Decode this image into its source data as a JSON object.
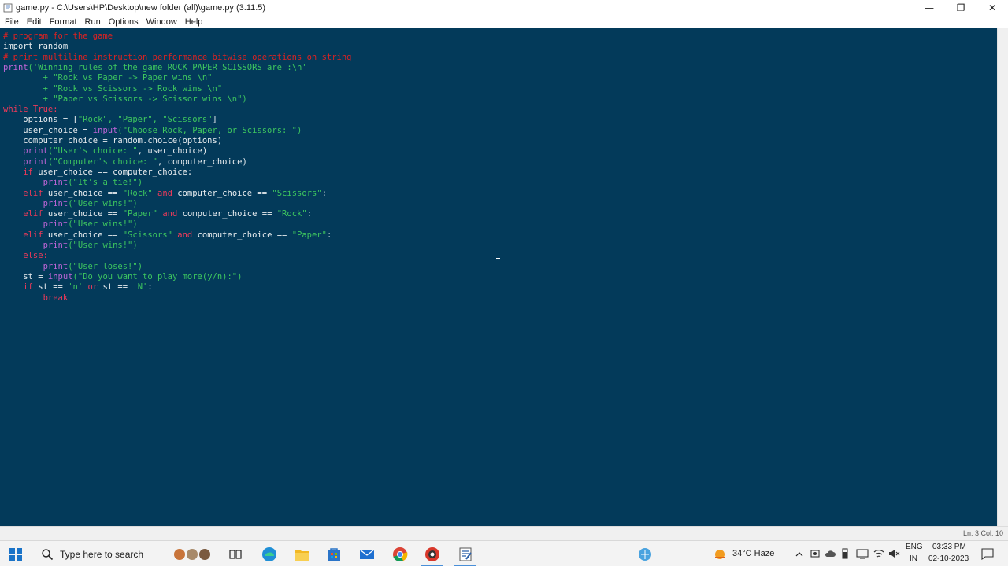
{
  "window": {
    "title": "game.py - C:\\Users\\HP\\Desktop\\new folder (all)\\game.py (3.11.5)",
    "controls": {
      "minimize": "—",
      "restore": "❐",
      "close": "✕"
    }
  },
  "menu": [
    "File",
    "Edit",
    "Format",
    "Run",
    "Options",
    "Window",
    "Help"
  ],
  "code_lines": [
    [
      {
        "t": "# program for the game",
        "c": "comment"
      }
    ],
    [
      {
        "t": "import random",
        "c": "plain"
      }
    ],
    [
      {
        "t": "# print multiline instruction performance bitwise operations on string",
        "c": "comment"
      }
    ],
    [
      {
        "t": "print",
        "c": "builtin"
      },
      {
        "t": "('Winning rules of the game ROCK PAPER SCISSORS are :\\n'",
        "c": "str"
      }
    ],
    [
      {
        "t": "        + \"Rock vs Paper -> Paper wins \\n\"",
        "c": "str"
      }
    ],
    [
      {
        "t": "        + \"Rock vs Scissors -> Rock wins \\n\"",
        "c": "str"
      }
    ],
    [
      {
        "t": "        + \"Paper vs Scissors -> Scissor wins \\n\")",
        "c": "str"
      }
    ],
    [
      {
        "t": "while True:",
        "c": "kw"
      }
    ],
    [
      {
        "t": "    options = [",
        "c": "plain"
      },
      {
        "t": "\"Rock\", \"Paper\", \"Scissors\"",
        "c": "str"
      },
      {
        "t": "]",
        "c": "plain"
      }
    ],
    [
      {
        "t": "    user_choice = ",
        "c": "plain"
      },
      {
        "t": "input",
        "c": "builtin"
      },
      {
        "t": "(\"Choose Rock, Paper, or Scissors: \")",
        "c": "str"
      }
    ],
    [
      {
        "t": "    computer_choice = random.choice(options)",
        "c": "plain"
      }
    ],
    [
      {
        "t": "    print",
        "c": "builtin"
      },
      {
        "t": "(\"User's choice: \"",
        "c": "str"
      },
      {
        "t": ", user_choice)",
        "c": "plain"
      }
    ],
    [
      {
        "t": "    print",
        "c": "builtin"
      },
      {
        "t": "(\"Computer's choice: \"",
        "c": "str"
      },
      {
        "t": ", computer_choice)",
        "c": "plain"
      }
    ],
    [
      {
        "t": "    if",
        "c": "kw"
      },
      {
        "t": " user_choice == computer_choice:",
        "c": "plain"
      }
    ],
    [
      {
        "t": "        print",
        "c": "builtin"
      },
      {
        "t": "(\"It's a tie!\")",
        "c": "str"
      }
    ],
    [
      {
        "t": "    elif",
        "c": "kw"
      },
      {
        "t": " user_choice == ",
        "c": "plain"
      },
      {
        "t": "\"Rock\"",
        "c": "str"
      },
      {
        "t": " and",
        "c": "kw"
      },
      {
        "t": " computer_choice == ",
        "c": "plain"
      },
      {
        "t": "\"Scissors\"",
        "c": "str"
      },
      {
        "t": ":",
        "c": "plain"
      }
    ],
    [
      {
        "t": "        print",
        "c": "builtin"
      },
      {
        "t": "(\"User wins!\")",
        "c": "str"
      }
    ],
    [
      {
        "t": "    elif",
        "c": "kw"
      },
      {
        "t": " user_choice == ",
        "c": "plain"
      },
      {
        "t": "\"Paper\"",
        "c": "str"
      },
      {
        "t": " and",
        "c": "kw"
      },
      {
        "t": " computer_choice == ",
        "c": "plain"
      },
      {
        "t": "\"Rock\"",
        "c": "str"
      },
      {
        "t": ":",
        "c": "plain"
      }
    ],
    [
      {
        "t": "        print",
        "c": "builtin"
      },
      {
        "t": "(\"User wins!\")",
        "c": "str"
      }
    ],
    [
      {
        "t": "    elif",
        "c": "kw"
      },
      {
        "t": " user_choice == ",
        "c": "plain"
      },
      {
        "t": "\"Scissors\"",
        "c": "str"
      },
      {
        "t": " and",
        "c": "kw"
      },
      {
        "t": " computer_choice == ",
        "c": "plain"
      },
      {
        "t": "\"Paper\"",
        "c": "str"
      },
      {
        "t": ":",
        "c": "plain"
      }
    ],
    [
      {
        "t": "        print",
        "c": "builtin"
      },
      {
        "t": "(\"User wins!\")",
        "c": "str"
      }
    ],
    [
      {
        "t": "    else:",
        "c": "kw"
      }
    ],
    [
      {
        "t": "        print",
        "c": "builtin"
      },
      {
        "t": "(\"User loses!\")",
        "c": "str"
      }
    ],
    [
      {
        "t": "    st = ",
        "c": "plain"
      },
      {
        "t": "input",
        "c": "builtin"
      },
      {
        "t": "(\"Do you want to play more(y/n):\")",
        "c": "str"
      }
    ],
    [
      {
        "t": "    if",
        "c": "kw"
      },
      {
        "t": " st == ",
        "c": "plain"
      },
      {
        "t": "'n'",
        "c": "str"
      },
      {
        "t": " or",
        "c": "kw"
      },
      {
        "t": " st == ",
        "c": "plain"
      },
      {
        "t": "'N'",
        "c": "str"
      },
      {
        "t": ":",
        "c": "plain"
      }
    ],
    [
      {
        "t": "        break",
        "c": "kw"
      }
    ]
  ],
  "status": {
    "position": "Ln: 3   Col: 10"
  },
  "taskbar": {
    "search_placeholder": "Type here to search",
    "weather": "34°C  Haze",
    "language_top": "ENG",
    "language_bottom": "IN",
    "time": "03:33 PM",
    "date": "02-10-2023"
  },
  "colors": {
    "editor_bg": "#033a5a",
    "comment": "#dd2222",
    "keyword": "#ee3a5a",
    "string": "#3ec75f",
    "plain": "#e8ecef"
  }
}
